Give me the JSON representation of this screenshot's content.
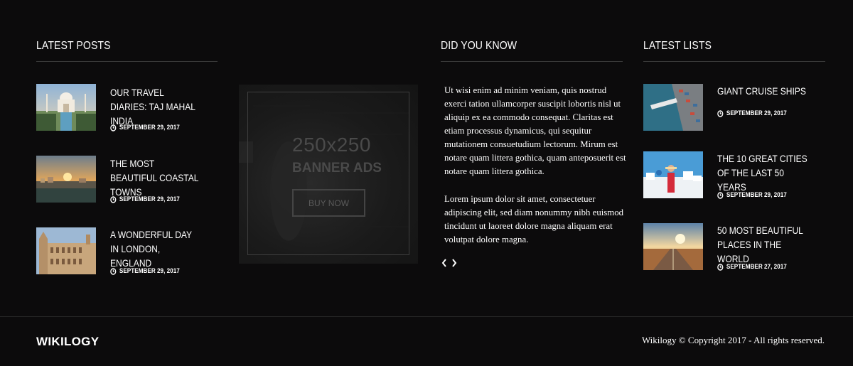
{
  "latest_posts": {
    "title": "LATEST POSTS",
    "items": [
      {
        "title": "OUR TRAVEL DIARIES: TAJ MAHAL INDIA",
        "date": "SEPTEMBER 29, 2017",
        "image": "taj-mahal-photo"
      },
      {
        "title": "THE MOST BEAUTIFUL COASTAL TOWNS",
        "date": "SEPTEMBER 29, 2017",
        "image": "coastal-sunset-photo"
      },
      {
        "title": "A WONDERFUL DAY IN LONDON, ENGLAND",
        "date": "SEPTEMBER 29, 2017",
        "image": "london-building-photo"
      }
    ]
  },
  "banner": {
    "size": "250x250",
    "label": "BANNER ADS",
    "button": "BUY NOW"
  },
  "did_you_know": {
    "title": "DID YOU KNOW",
    "paragraphs": [
      "Ut wisi enim ad minim veniam, quis nostrud exerci tation ullamcorper suscipit lobortis nisl ut aliquip ex ea commodo consequat. Claritas est etiam processus dynamicus, qui sequitur mutationem consuetudium lectorum. Mirum est notare quam littera gothica, quam anteposuerit est notare quam littera gothica.",
      "Lorem ipsum dolor sit amet, consectetuer adipiscing elit, sed diam nonummy nibh euismod tincidunt ut laoreet dolore magna aliquam erat volutpat dolore magna."
    ],
    "prev_icon": "chevron-left-icon",
    "next_icon": "chevron-right-icon"
  },
  "latest_lists": {
    "title": "LATEST LISTS",
    "items": [
      {
        "title": "GIANT CRUISE SHIPS",
        "date": "SEPTEMBER 29, 2017",
        "image": "port-aerial-photo"
      },
      {
        "title": "THE 10 GREAT CITIES OF THE LAST 50 YEARS",
        "date": "SEPTEMBER 29, 2017",
        "image": "santorini-photo"
      },
      {
        "title": "50 MOST BEAUTIFUL PLACES IN THE WORLD",
        "date": "SEPTEMBER 27, 2017",
        "image": "desert-road-photo"
      }
    ]
  },
  "footer": {
    "logo": "WIKILOGY",
    "copyright": "Wikilogy © Copyright 2017 - All rights reserved."
  },
  "colors": {
    "background": "#0c0b0c",
    "text": "#ffffff",
    "rule": "#3a3a3a"
  }
}
